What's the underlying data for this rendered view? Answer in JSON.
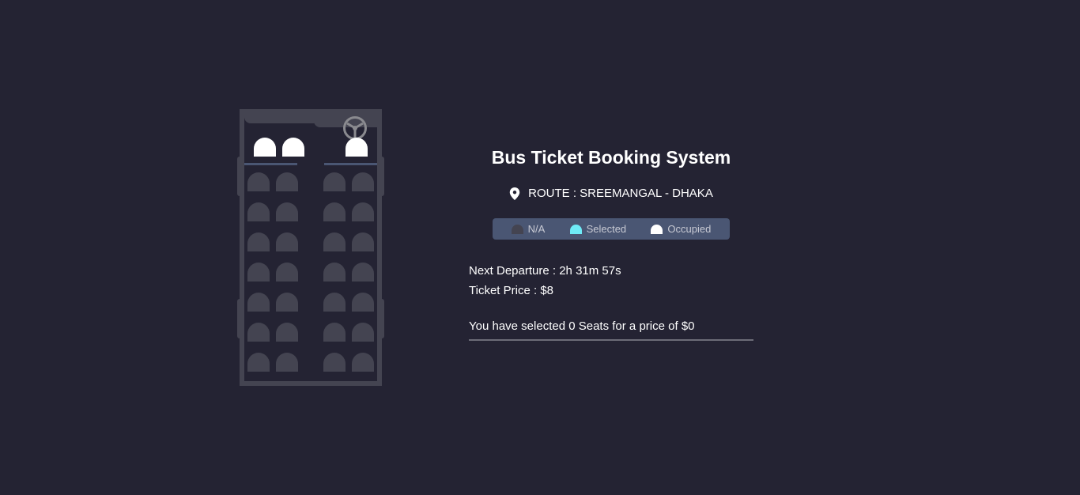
{
  "header": {
    "title": "Bus Ticket Booking System",
    "route": "ROUTE : SREEMANGAL - DHAKA"
  },
  "legend": [
    {
      "label": "N/A",
      "color": "#444451"
    },
    {
      "label": "Selected",
      "color": "#6feaf6"
    },
    {
      "label": "Occupied",
      "color": "#ffffff"
    }
  ],
  "info": {
    "departure_label": "Next Departure :",
    "departure_value": "2h 31m 57s",
    "price_label": "Ticket Price :",
    "price_value": "$8"
  },
  "summary": {
    "prefix": "You have selected",
    "count": "0",
    "middle": "Seats for a price of",
    "total": "$0"
  },
  "bus": {
    "front_row": [
      "occupied",
      "occupied",
      "driver"
    ],
    "rows": 7,
    "seats_per_side": 2
  },
  "colors": {
    "background": "#242333",
    "seat_na": "#444451",
    "seat_selected": "#6feaf6",
    "seat_occupied": "#ffffff",
    "legend_bg": "#4a5673"
  }
}
